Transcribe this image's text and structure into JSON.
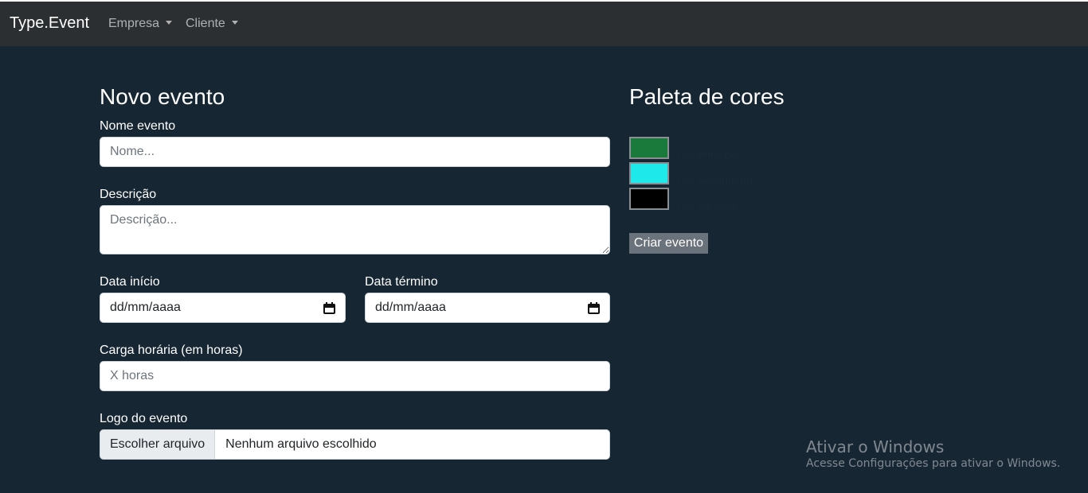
{
  "navbar": {
    "brand": "Type.Event",
    "items": [
      {
        "label": "Empresa"
      },
      {
        "label": "Cliente"
      }
    ]
  },
  "form": {
    "title": "Novo evento",
    "nome": {
      "label": "Nome evento",
      "placeholder": "Nome..."
    },
    "descricao": {
      "label": "Descrição",
      "placeholder": "Descrição..."
    },
    "data_inicio": {
      "label": "Data início",
      "value": "dd/mm/aaaa"
    },
    "data_termino": {
      "label": "Data término",
      "value": "dd/mm/aaaa"
    },
    "carga": {
      "label": "Carga horária (em horas)",
      "placeholder": "X horas"
    },
    "logo": {
      "label": "Logo do evento",
      "button": "Escolher arquivo",
      "file": "Nenhum arquivo escolhido"
    }
  },
  "palette": {
    "title": "Paleta de cores",
    "colors": [
      {
        "value": "#1a7a3c",
        "label": "Cor principal"
      },
      {
        "value": "#1ee8ea",
        "label": "Cor secundária"
      },
      {
        "value": "#000000",
        "label": "Cor do texto"
      }
    ],
    "create_button": "Criar evento"
  },
  "watermark": {
    "title": "Ativar o Windows",
    "subtitle": "Acesse Configurações para ativar o Windows."
  }
}
